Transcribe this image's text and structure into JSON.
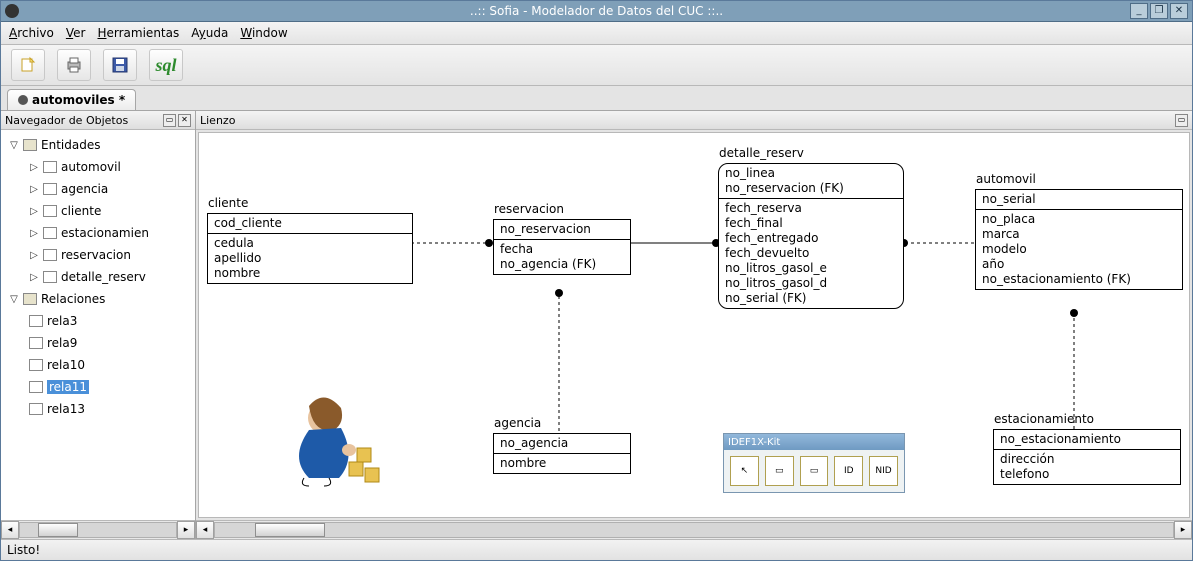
{
  "window": {
    "title": "..:: Sofia - Modelador de Datos del CUC ::.."
  },
  "menu": {
    "archivo": "Archivo",
    "ver": "Ver",
    "herramientas": "Herramientas",
    "ayuda": "Ayuda",
    "window": "Window"
  },
  "toolbar": {
    "new": "new-icon",
    "print": "print-icon",
    "save": "save-icon",
    "sql": "sql-icon"
  },
  "tab": {
    "label": "automoviles *"
  },
  "sidebar": {
    "title": "Navegador de Objetos",
    "entidades_label": "Entidades",
    "relaciones_label": "Relaciones",
    "entidades": [
      {
        "label": "automovil"
      },
      {
        "label": "agencia"
      },
      {
        "label": "cliente"
      },
      {
        "label": "estacionamien"
      },
      {
        "label": "reservacion"
      },
      {
        "label": "detalle_reserv"
      }
    ],
    "relaciones": [
      {
        "label": "rela3"
      },
      {
        "label": "rela9"
      },
      {
        "label": "rela10"
      },
      {
        "label": "rela11",
        "selected": true
      },
      {
        "label": "rela13"
      }
    ]
  },
  "canvas": {
    "title": "Lienzo",
    "entities": {
      "cliente": {
        "title": "cliente",
        "pk": [
          "cod_cliente"
        ],
        "attrs": [
          "cedula",
          "apellido",
          "nombre"
        ]
      },
      "reservacion": {
        "title": "reservacion",
        "pk": [
          "no_reservacion"
        ],
        "attrs": [
          "fecha",
          "no_agencia (FK)"
        ]
      },
      "detalle_reserv": {
        "title": "detalle_reserv",
        "pk": [
          "no_linea",
          "no_reservacion (FK)"
        ],
        "attrs": [
          "fech_reserva",
          "fech_final",
          "fech_entregado",
          "fech_devuelto",
          "no_litros_gasol_e",
          "no_litros_gasol_d",
          "no_serial (FK)"
        ]
      },
      "automovil": {
        "title": "automovil",
        "pk": [
          "no_serial"
        ],
        "attrs": [
          "no_placa",
          "marca",
          "modelo",
          "año",
          "no_estacionamiento (FK)"
        ]
      },
      "agencia": {
        "title": "agencia",
        "pk": [
          "no_agencia"
        ],
        "attrs": [
          "nombre"
        ]
      },
      "estacionamiento": {
        "title": "estacionamiento",
        "pk": [
          "no_estacionamiento"
        ],
        "attrs": [
          "dirección",
          "telefono"
        ]
      }
    },
    "toolbox": {
      "title": "IDEF1X-Kit",
      "items": [
        "↖",
        "▭",
        "▭",
        "ID",
        "NID"
      ]
    }
  },
  "status": {
    "text": "Listo!"
  }
}
